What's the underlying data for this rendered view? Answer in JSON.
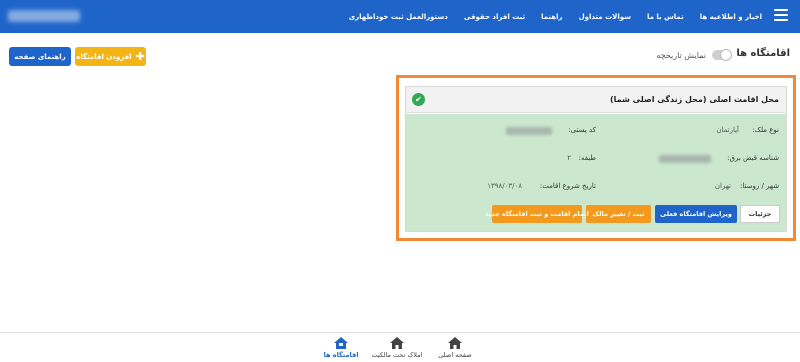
{
  "nav": {
    "items": [
      "اخبار و اطلاعیه ها",
      "تماس با ما",
      "سوالات متداول",
      "راهنما",
      "ثبت افراد حقوقی",
      "دستورالعمل ثبت خوداظهاری"
    ]
  },
  "header": {
    "title": "اقامتگاه ها",
    "history_toggle": "نمایش تاریخچه",
    "add_button": "افزودن اقامتگاه",
    "guide_button": "راهنمای صفحه"
  },
  "card": {
    "title": "محل اقامت اصلی (محل زندگی اصلی شما)",
    "fields": {
      "property_type_label": "نوع ملک:",
      "property_type_value": "آپارتمان",
      "postal_code_label": "کد پستی:",
      "bill_id_label": "شناسه قبض برق:",
      "floor_label": "طبقه:",
      "floor_value": "۲",
      "city_label": "شهر / روستا:",
      "city_value": "تهران",
      "start_date_label": "تاریخ شروع اقامت:",
      "start_date_value": "۱۳۹۸/۰۳/۰۸"
    },
    "actions": {
      "details": "جزئیات",
      "edit": "ویرایش اقامتگاه فعلی",
      "owner": "ثبت / تغییر مالک",
      "finish": "اتمام اقامت و ثبت اقامتگاه جدید"
    }
  },
  "tabs": [
    "صفحه اصلی",
    "املاک تحت مالکیت",
    "اقامتگاه ها"
  ],
  "colors": {
    "primary": "#1f65c9",
    "warning": "#f3b416",
    "orange": "#f39a1e",
    "highlight_border": "#f08a35",
    "card_body": "#cbe8cf",
    "success": "#34a853"
  }
}
